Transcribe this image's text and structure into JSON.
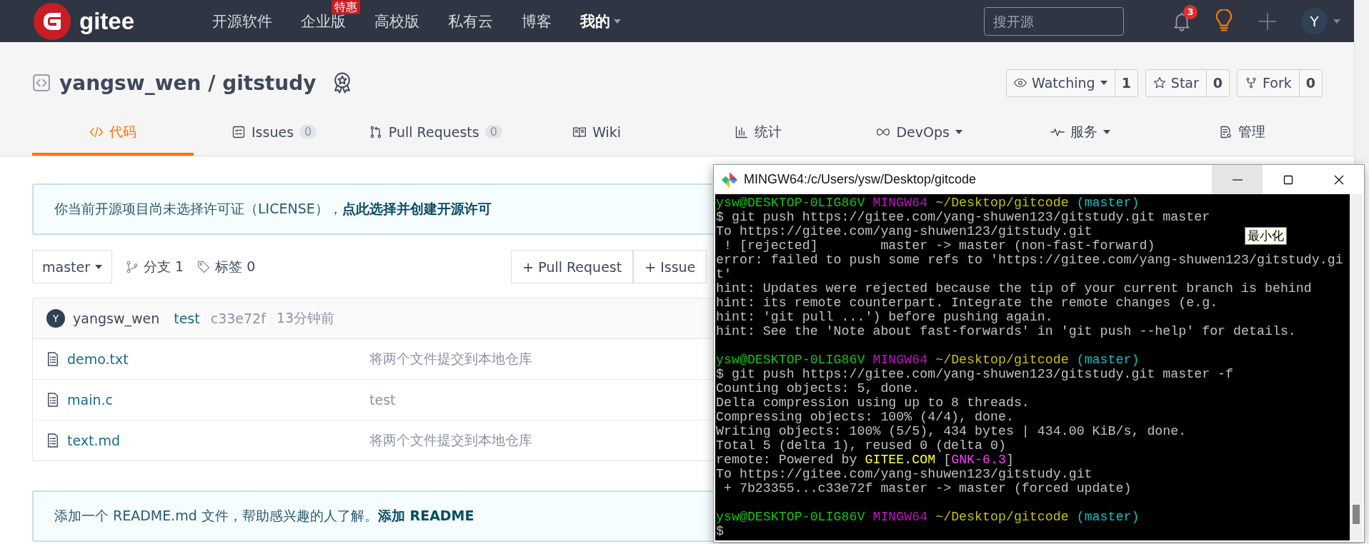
{
  "navbar": {
    "logo": "gitee",
    "items": [
      {
        "label": "开源软件",
        "selected": false
      },
      {
        "label": "企业版",
        "selected": false,
        "badge": "特惠"
      },
      {
        "label": "高校版",
        "selected": false
      },
      {
        "label": "私有云",
        "selected": false
      },
      {
        "label": "博客",
        "selected": false
      },
      {
        "label": "我的",
        "selected": true,
        "dropdown": true
      }
    ],
    "search": {
      "placeholder": "搜开源"
    },
    "notification_count": "3",
    "avatar": "Y"
  },
  "repo": {
    "title": "yangsw_wen / gitstudy",
    "actions": [
      {
        "kind": "watch",
        "label": "Watching",
        "count": "1",
        "dropdown": true
      },
      {
        "kind": "star",
        "label": "Star",
        "count": "0"
      },
      {
        "kind": "fork",
        "label": "Fork",
        "count": "0"
      }
    ],
    "tabs": [
      {
        "kind": "code",
        "label": "代码",
        "selected": true
      },
      {
        "kind": "issues",
        "label": "Issues",
        "count": "0",
        "selected": false
      },
      {
        "kind": "pulls",
        "label": "Pull Requests",
        "count": "0",
        "selected": false
      },
      {
        "kind": "wiki",
        "label": "Wiki",
        "selected": false
      },
      {
        "kind": "stats",
        "label": "统计",
        "selected": false
      },
      {
        "kind": "devops",
        "label": "DevOps",
        "selected": false,
        "dropdown": true
      },
      {
        "kind": "services",
        "label": "服务",
        "selected": false,
        "dropdown": true
      },
      {
        "kind": "manage",
        "label": "管理",
        "selected": false
      }
    ]
  },
  "license_notice": {
    "text": "你当前开源项目尚未选择许可证（LICENSE），",
    "link": "点此选择并创建开源许可"
  },
  "branch_bar": {
    "branch": "master",
    "branches": "分支 1",
    "tags": "标签 0",
    "buttons": [
      "+ Pull Request",
      "+ Issue"
    ]
  },
  "commit": {
    "avatar": "Y",
    "author": "yangsw_wen",
    "message": "test",
    "hash": "c33e72f",
    "time": "13分钟前"
  },
  "files": [
    {
      "name": "demo.txt",
      "message": "将两个文件提交到本地仓库"
    },
    {
      "name": "main.c",
      "message": "test"
    },
    {
      "name": "text.md",
      "message": "将两个文件提交到本地仓库"
    }
  ],
  "readme_notice": {
    "text": "添加一个 README.md 文件，帮助感兴趣的人了解。",
    "link": "添加 README"
  },
  "terminal": {
    "title": "MINGW64:/c/Users/ysw/Desktop/gitcode",
    "window_buttons": [
      {
        "kind": "minimize",
        "hovered": true
      },
      {
        "kind": "maximize",
        "hovered": false
      },
      {
        "kind": "close",
        "hovered": false
      }
    ],
    "tooltip": "最小化",
    "lines": [
      {
        "kind": "text",
        "spans": [
          {
            "text": "ysw@DESKTOP-0LIG86V ",
            "color": "#13c313"
          },
          {
            "text": "MINGW64 ",
            "color": "#c013c0"
          },
          {
            "text": "~/Desktop/gitcode ",
            "color": "#c0c013"
          },
          {
            "text": "(master)",
            "color": "#13c0c0"
          }
        ]
      },
      {
        "kind": "text",
        "spans": [
          {
            "text": "$ git push https://gitee.com/yang-shuwen123/gitstudy.git master",
            "color": "#c0c0c0"
          }
        ]
      },
      {
        "kind": "text",
        "spans": [
          {
            "text": "To https://gitee.com/yang-shuwen123/gitstudy.git",
            "color": "#c0c0c0"
          }
        ]
      },
      {
        "kind": "text",
        "spans": [
          {
            "text": " ! [rejected]        master -> master (non-fast-forward)",
            "color": "#c0c0c0"
          }
        ]
      },
      {
        "kind": "text",
        "spans": [
          {
            "text": "error: failed to push some refs to 'https://gitee.com/yang-shuwen123/gitstudy.gi",
            "color": "#c0c0c0"
          }
        ]
      },
      {
        "kind": "text",
        "spans": [
          {
            "text": "t'",
            "color": "#c0c0c0"
          }
        ]
      },
      {
        "kind": "text",
        "spans": [
          {
            "text": "hint: Updates were rejected because the tip of your current branch is behind",
            "color": "#c0c0c0"
          }
        ]
      },
      {
        "kind": "text",
        "spans": [
          {
            "text": "hint: its remote counterpart. Integrate the remote changes (e.g.",
            "color": "#c0c0c0"
          }
        ]
      },
      {
        "kind": "text",
        "spans": [
          {
            "text": "hint: 'git pull ...') before pushing again.",
            "color": "#c0c0c0"
          }
        ]
      },
      {
        "kind": "text",
        "spans": [
          {
            "text": "hint: See the 'Note about fast-forwards' in 'git push --help' for details.",
            "color": "#c0c0c0"
          }
        ]
      },
      {
        "kind": "blank"
      },
      {
        "kind": "text",
        "spans": [
          {
            "text": "ysw@DESKTOP-0LIG86V ",
            "color": "#13c313"
          },
          {
            "text": "MINGW64 ",
            "color": "#c013c0"
          },
          {
            "text": "~/Desktop/gitcode ",
            "color": "#c0c013"
          },
          {
            "text": "(master)",
            "color": "#13c0c0"
          }
        ]
      },
      {
        "kind": "text",
        "spans": [
          {
            "text": "$ git push https://gitee.com/yang-shuwen123/gitstudy.git master -f",
            "color": "#c0c0c0"
          }
        ]
      },
      {
        "kind": "text",
        "spans": [
          {
            "text": "Counting objects: 5, done.",
            "color": "#c0c0c0"
          }
        ]
      },
      {
        "kind": "text",
        "spans": [
          {
            "text": "Delta compression using up to 8 threads.",
            "color": "#c0c0c0"
          }
        ]
      },
      {
        "kind": "text",
        "spans": [
          {
            "text": "Compressing objects: 100% (4/4), done.",
            "color": "#c0c0c0"
          }
        ]
      },
      {
        "kind": "text",
        "spans": [
          {
            "text": "Writing objects: 100% (5/5), 434 bytes | 434.00 KiB/s, done.",
            "color": "#c0c0c0"
          }
        ]
      },
      {
        "kind": "text",
        "spans": [
          {
            "text": "Total 5 (delta 1), reused 0 (delta 0)",
            "color": "#c0c0c0"
          }
        ]
      },
      {
        "kind": "text",
        "spans": [
          {
            "text": "remote: Powered by ",
            "color": "#c0c0c0"
          },
          {
            "text": "GITEE.COM",
            "color": "#ffff3c"
          },
          {
            "text": " [",
            "color": "#c0c0c0"
          },
          {
            "text": "GNK-6.3",
            "color": "#ff3cff"
          },
          {
            "text": "]",
            "color": "#c0c0c0"
          }
        ]
      },
      {
        "kind": "text",
        "spans": [
          {
            "text": "To https://gitee.com/yang-shuwen123/gitstudy.git",
            "color": "#c0c0c0"
          }
        ]
      },
      {
        "kind": "text",
        "spans": [
          {
            "text": " + 7b23355...c33e72f master -> master (forced update)",
            "color": "#c0c0c0"
          }
        ]
      },
      {
        "kind": "blank"
      },
      {
        "kind": "text",
        "spans": [
          {
            "text": "ysw@DESKTOP-0LIG86V ",
            "color": "#13c313"
          },
          {
            "text": "MINGW64 ",
            "color": "#c013c0"
          },
          {
            "text": "~/Desktop/gitcode ",
            "color": "#c0c013"
          },
          {
            "text": "(master)",
            "color": "#13c0c0"
          }
        ]
      },
      {
        "kind": "text",
        "spans": [
          {
            "text": "$",
            "color": "#c0c0c0"
          }
        ]
      }
    ]
  }
}
